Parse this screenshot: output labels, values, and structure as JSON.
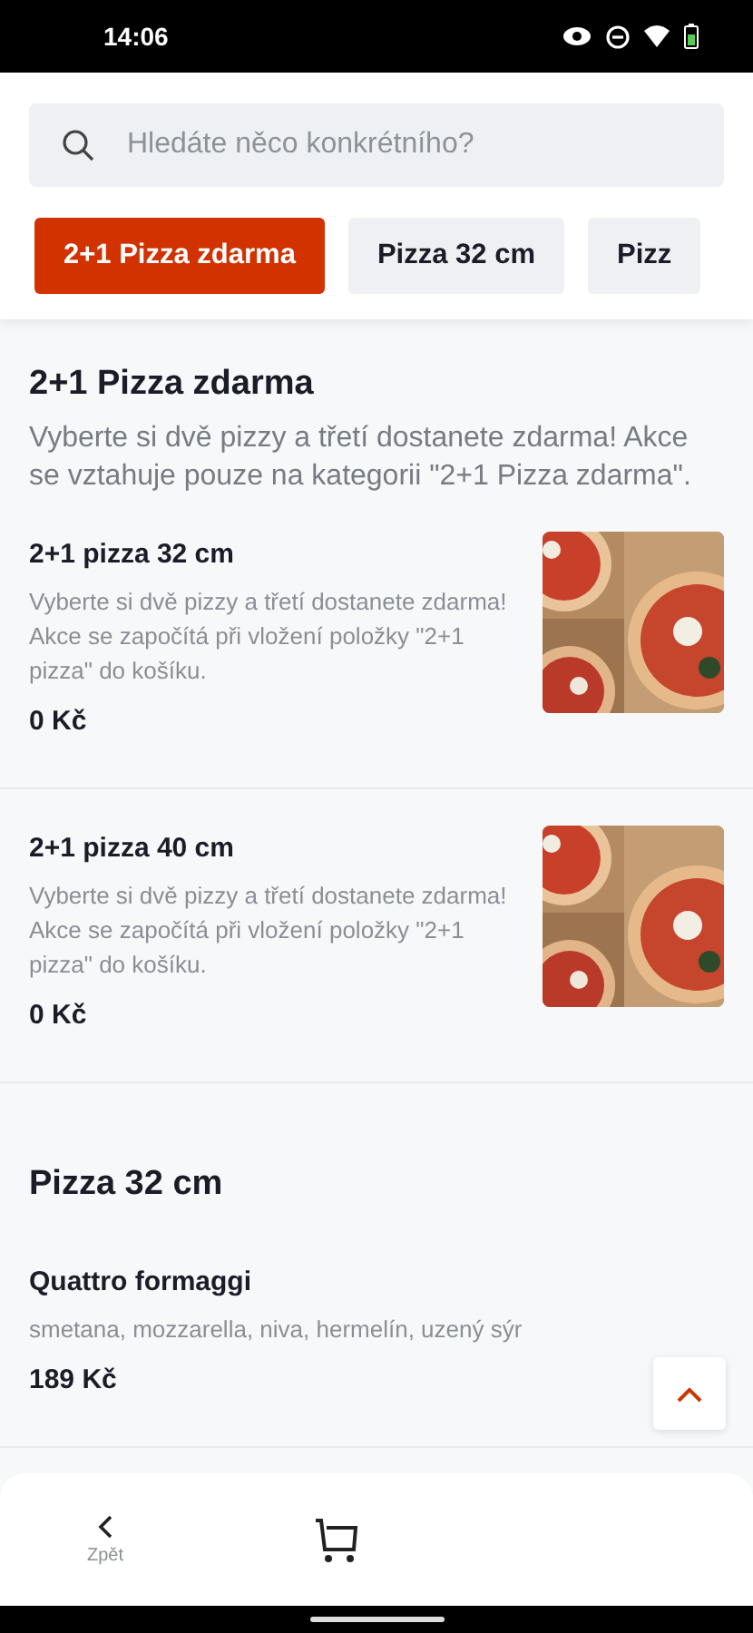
{
  "status_bar": {
    "time": "14:06"
  },
  "search": {
    "placeholder": "Hledáte něco konkrétního?"
  },
  "tabs": [
    {
      "label": "2+1 Pizza zdarma",
      "selected": true
    },
    {
      "label": "Pizza 32 cm",
      "selected": false
    },
    {
      "label": "Pizz",
      "selected": false
    }
  ],
  "sections": [
    {
      "title": "2+1 Pizza zdarma",
      "description": "Vyberte si dvě pizzy a třetí dostanete zdarma! Akce se vztahuje pouze na kategorii \"2+1 Pizza zdarma\".",
      "items": [
        {
          "name": "2+1 pizza 32 cm",
          "description": "Vyberte si dvě pizzy a třetí dostanete zdarma! Akce se započítá při vložení položky \"2+1 pizza\" do košíku.",
          "price": "0 Kč"
        },
        {
          "name": "2+1 pizza 40 cm",
          "description": "Vyberte si dvě pizzy a třetí dostanete zdarma! Akce se započítá při vložení položky \"2+1 pizza\" do košíku.",
          "price": "0 Kč"
        }
      ]
    },
    {
      "title": "Pizza 32 cm",
      "items": [
        {
          "name": "Quattro formaggi",
          "description": "smetana, mozzarella, niva, hermelín, uzený sýr",
          "price": "189 Kč"
        }
      ]
    }
  ],
  "bottom_bar": {
    "back_label": "Zpět"
  }
}
